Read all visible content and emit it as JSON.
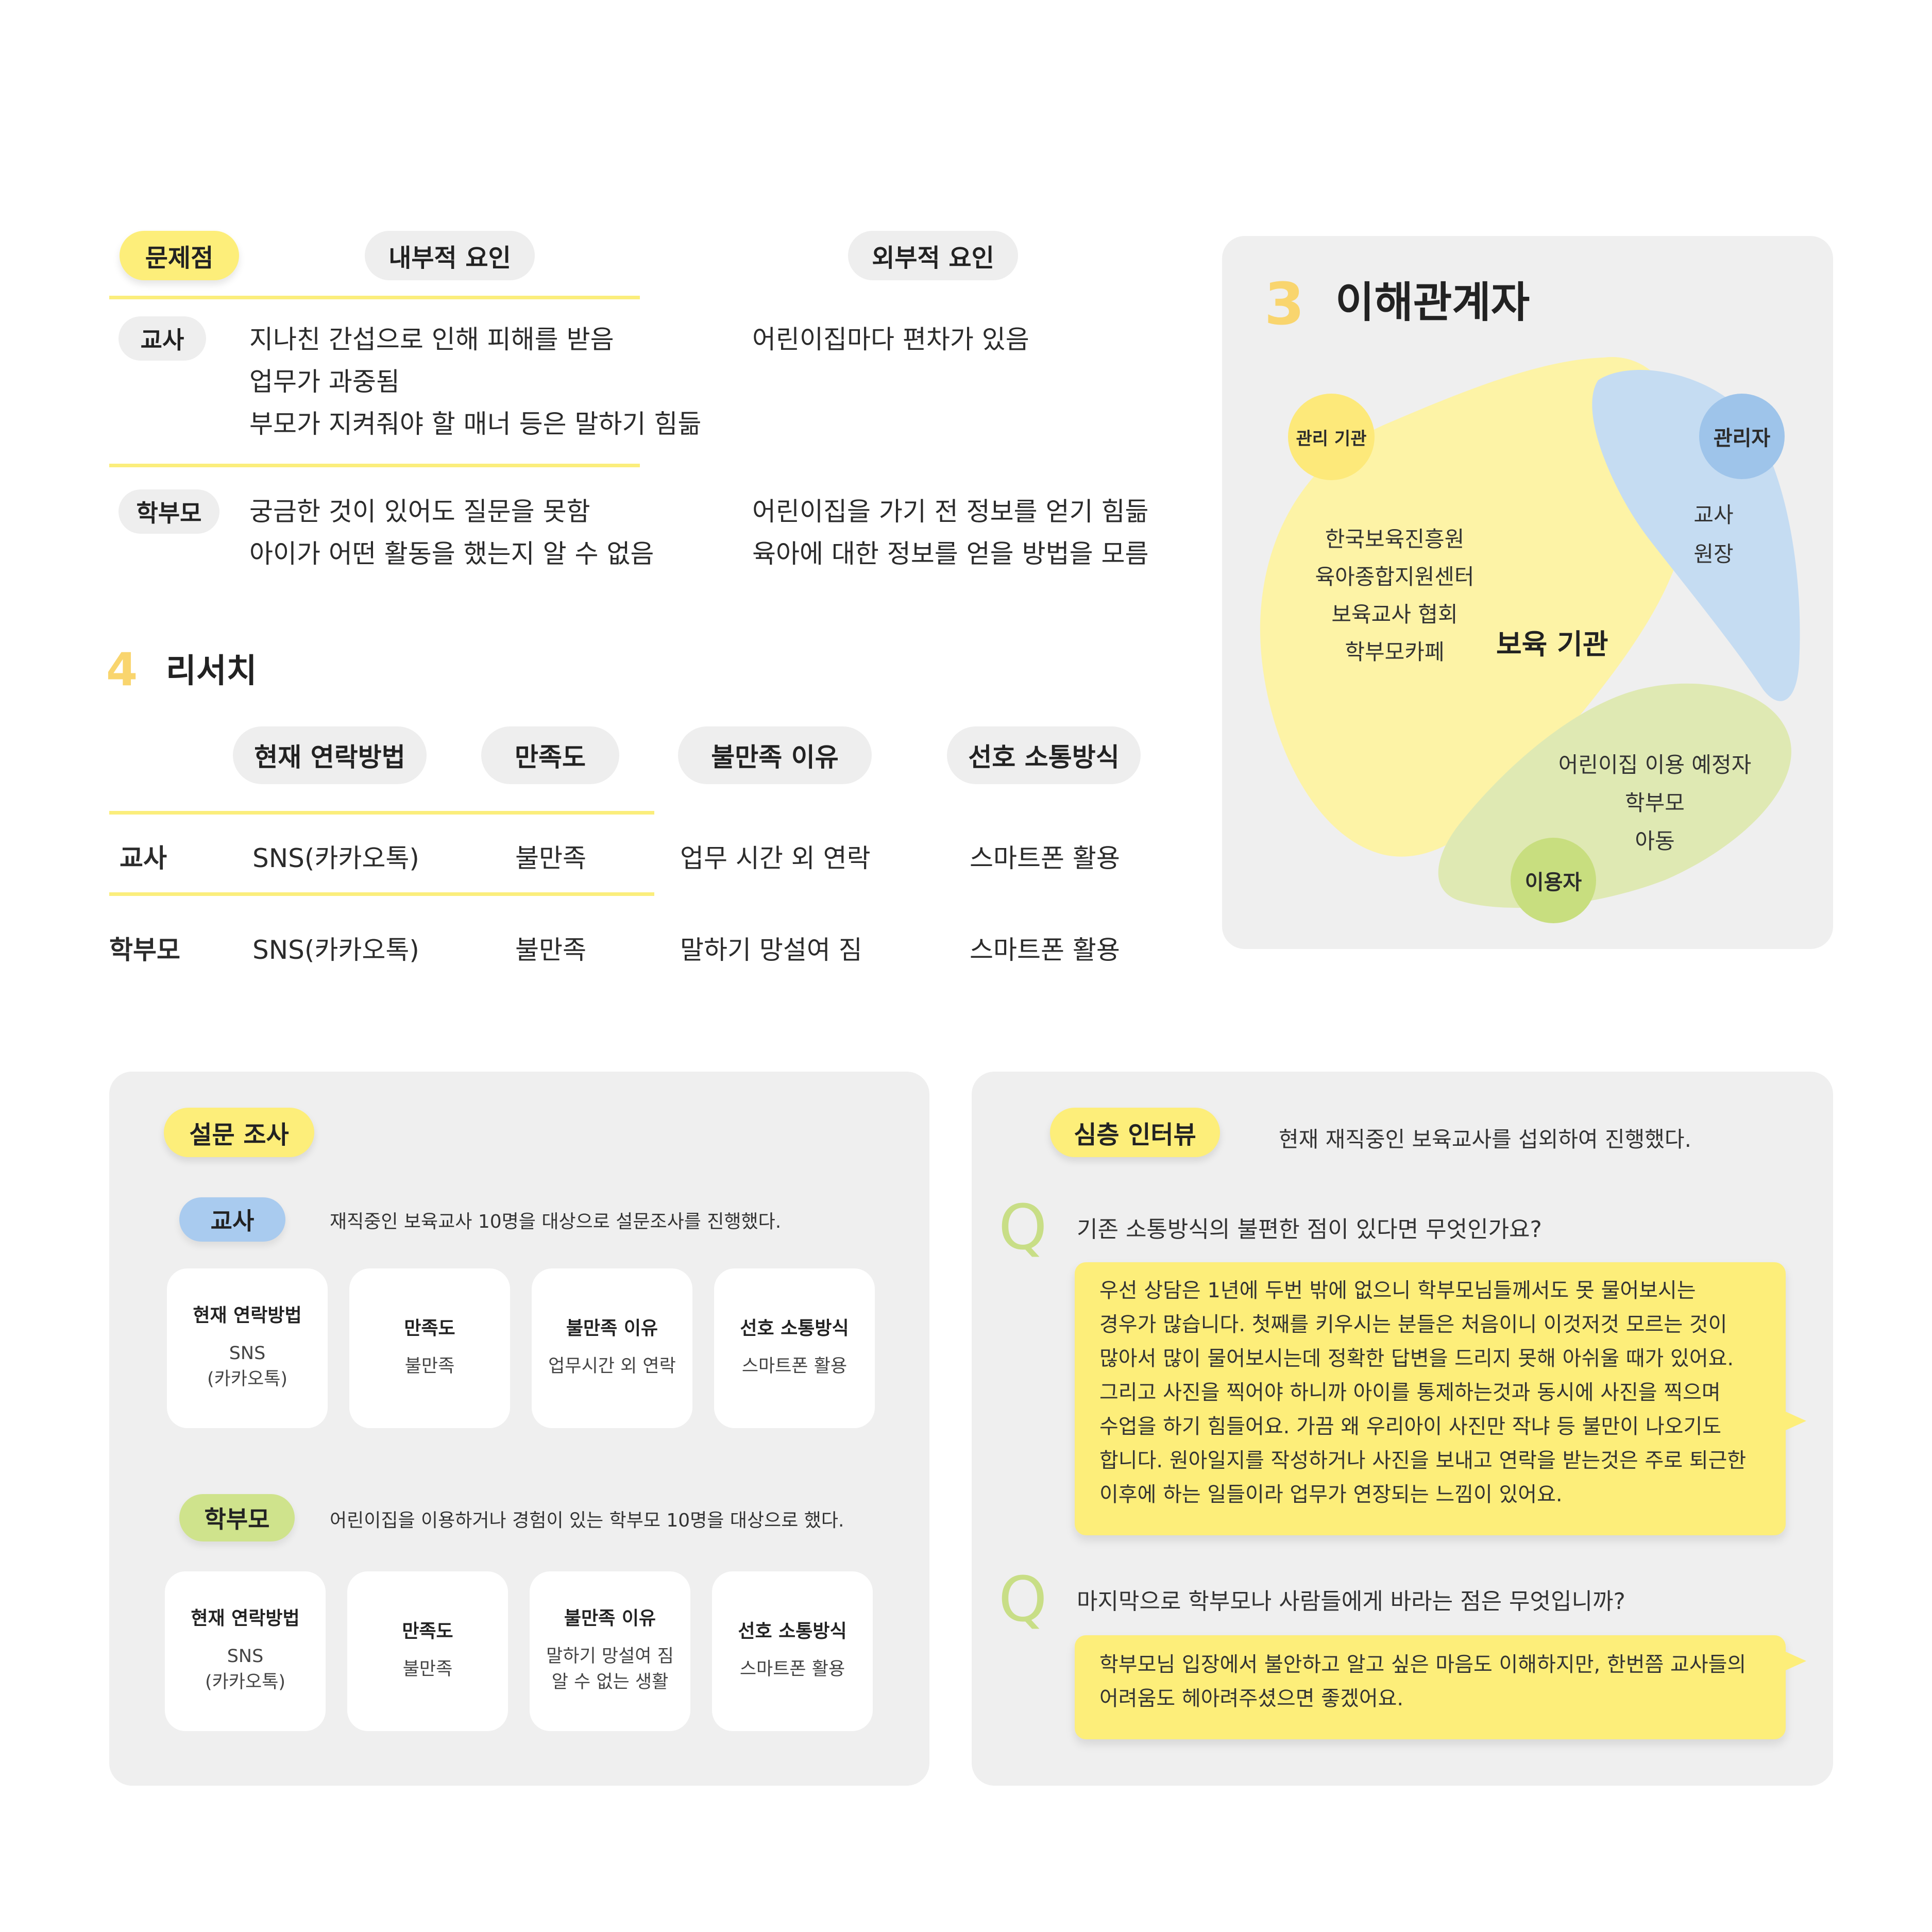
{
  "problems": {
    "headers": {
      "problem": "문제점",
      "internal": "내부적 요인",
      "external": "외부적 요인"
    },
    "rows": [
      {
        "label": "교사",
        "internal": [
          "지나친 간섭으로 인해 피해를 받음",
          "업무가 과중됨",
          "부모가 지켜줘야 할 매너 등은 말하기 힘듦"
        ],
        "external": [
          "어린이집마다 편차가 있음"
        ]
      },
      {
        "label": "학부모",
        "internal": [
          "궁금한 것이 있어도 질문을 못함",
          "아이가 어떤 활동을 했는지 알 수 없음"
        ],
        "external": [
          "어린이집을 가기 전 정보를 얻기 힘듦",
          "육아에 대한 정보를 얻을 방법을 모름"
        ]
      }
    ]
  },
  "research": {
    "number": "4",
    "title": "리서치",
    "headers": [
      "현재 연락방법",
      "만족도",
      "불만족 이유",
      "선호 소통방식"
    ],
    "rows": [
      {
        "label": "교사",
        "cells": [
          "SNS(카카오톡)",
          "불만족",
          "업무 시간 외 연락",
          "스마트폰 활용"
        ]
      },
      {
        "label": "학부모",
        "cells": [
          "SNS(카카오톡)",
          "불만족",
          "말하기 망설여 짐",
          "스마트폰 활용"
        ]
      }
    ]
  },
  "stakeholders": {
    "number": "3",
    "title": "이해관계자",
    "management": {
      "badge": "관리 기관",
      "items": [
        "한국보육진흥원",
        "육아종합지원센터",
        "보육교사 협회",
        "학부모카페"
      ]
    },
    "center_label": "보육 기관",
    "admin": {
      "badge": "관리자",
      "items": [
        "교사",
        "원장"
      ]
    },
    "user": {
      "badge": "이용자",
      "items": [
        "어린이집 이용 예정자",
        "학부모",
        "아동"
      ]
    },
    "colors": {
      "yellow": "#fdf3a6",
      "blue": "#c5dcf2",
      "green": "#dfe9b3"
    }
  },
  "survey": {
    "title": "설문 조사",
    "groups": [
      {
        "label": "교사",
        "desc": "재직중인 보육교사 10명을 대상으로 설문조사를 진행했다.",
        "cards": [
          {
            "title": "현재 연락방법",
            "value": "SNS\n(카카오톡)"
          },
          {
            "title": "만족도",
            "value": "불만족"
          },
          {
            "title": "불만족 이유",
            "value": "업무시간 외 연락"
          },
          {
            "title": "선호 소통방식",
            "value": "스마트폰 활용"
          }
        ]
      },
      {
        "label": "학부모",
        "desc": "어린이집을 이용하거나 경험이 있는 학부모 10명을 대상으로 했다.",
        "cards": [
          {
            "title": "현재 연락방법",
            "value": "SNS\n(카카오톡)"
          },
          {
            "title": "만족도",
            "value": "불만족"
          },
          {
            "title": "불만족 이유",
            "value": "말하기 망설여 짐\n알 수  없는 생활"
          },
          {
            "title": "선호 소통방식",
            "value": "스마트폰 활용"
          }
        ]
      }
    ]
  },
  "interview": {
    "title": "심층 인터뷰",
    "desc": "현재 재직중인 보육교사를 섭외하여 진행했다.",
    "q_mark": "Q",
    "qas": [
      {
        "question": "기존 소통방식의 불편한 점이 있다면 무엇인가요?",
        "answer": [
          "우선  상담은  1년에  두번  밖에  없으니  학부모님들께서도  못  물어보시는",
          "경우가 많습니다. 첫째를 키우시는 분들은 처음이니 이것저것 모르는 것이",
          "많아서 많이 물어보시는데 정확한 답변을 드리지 못해 아쉬울 때가 있어요.",
          "그리고 사진을 찍어야 하니까 아이를 통제하는것과 동시에 사진을 찍으며",
          "수업을 하기 힘들어요. 가끔 왜 우리아이 사진만 작냐 등 불만이 나오기도",
          "합니다. 원아일지를 작성하거나 사진을 보내고 연락을 받는것은 주로 퇴근한",
          " 이후에 하는 일들이라 업무가 연장되는 느낌이 있어요."
        ]
      },
      {
        "question": "마지막으로 학부모나 사람들에게 바라는 점은 무엇입니까?",
        "answer": [
          "학부모님 입장에서 불안하고 알고 싶은 마음도 이해하지만, 한번쯤 교사들의",
          "어려움도 헤아려주셨으면 좋겠어요."
        ]
      }
    ]
  }
}
